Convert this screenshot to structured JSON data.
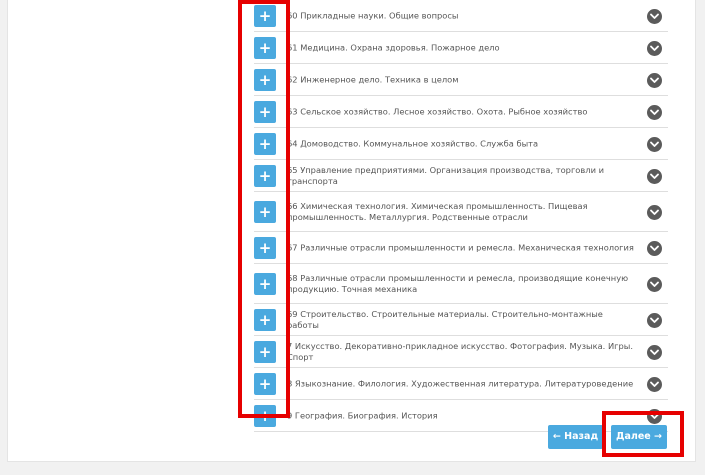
{
  "rows": [
    {
      "label": "60 Прикладные науки. Общие вопросы"
    },
    {
      "label": "61 Медицина. Охрана здоровья. Пожарное дело"
    },
    {
      "label": "62 Инженерное дело. Техника в целом"
    },
    {
      "label": "63 Сельское хозяйство. Лесное хозяйство. Охота. Рыбное хозяйство"
    },
    {
      "label": "64 Домоводство. Коммунальное хозяйство. Служба быта"
    },
    {
      "label": "65 Управление предприятиями. Организация производства, торговли и транспорта"
    },
    {
      "label": "66 Химическая технология. Химическая промышленность. Пищевая промышленность. Металлургия. Родственные отрасли"
    },
    {
      "label": "67 Различные отрасли промышленности и ремесла. Механическая технология"
    },
    {
      "label": "68 Различные отрасли промышленности и ремесла, производящие конечную продукцию. Точная механика"
    },
    {
      "label": "69 Строительство. Строительные материалы. Строительно-монтажные работы"
    },
    {
      "label": "7 Искусство. Декоративно-прикладное искусство. Фотография. Музыка. Игры. Спорт"
    },
    {
      "label": "8 Языкознание. Филология. Художественная литература. Литературоведение"
    },
    {
      "label": "9 География. Биография. История"
    }
  ],
  "add_glyph": "+",
  "nav": {
    "back_label": "Назад",
    "back_arrow": "←",
    "next_label": "Далее",
    "next_arrow": "→"
  },
  "colors": {
    "button_blue": "#4aa9df",
    "chevron_gray": "#5b5b5b",
    "highlight_red": "#e60000"
  }
}
